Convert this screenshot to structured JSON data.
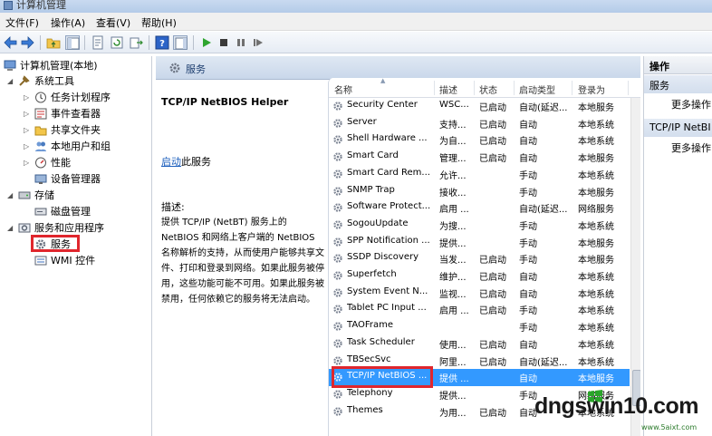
{
  "window": {
    "title": "计算机管理"
  },
  "menu": [
    "文件(F)",
    "操作(A)",
    "查看(V)",
    "帮助(H)"
  ],
  "tree": {
    "root": "计算机管理(本地)",
    "system_tools": "系统工具",
    "task_scheduler": "任务计划程序",
    "event_viewer": "事件查看器",
    "shared_folders": "共享文件夹",
    "local_users": "本地用户和组",
    "performance": "性能",
    "device_manager": "设备管理器",
    "storage": "存储",
    "disk_management": "磁盘管理",
    "services_apps": "服务和应用程序",
    "services": "服务",
    "wmi": "WMI 控件"
  },
  "panel": {
    "title": "服务",
    "service_name": "TCP/IP NetBIOS Helper",
    "start_link": "启动",
    "start_suffix": "此服务",
    "desc_label": "描述:",
    "desc_text": "提供 TCP/IP (NetBT) 服务上的 NetBIOS 和网络上客户端的 NetBIOS 名称解析的支持，从而使用户能够共享文件、打印和登录到网络。如果此服务被停用，这些功能可能不可用。如果此服务被禁用，任何依赖它的服务将无法启动。"
  },
  "columns": {
    "name": "名称",
    "desc": "描述",
    "status": "状态",
    "startup": "启动类型",
    "logon": "登录为"
  },
  "services": [
    {
      "name": "Security Center",
      "desc": "WSC...",
      "status": "已启动",
      "startup": "自动(延迟...",
      "logon": "本地服务"
    },
    {
      "name": "Server",
      "desc": "支持...",
      "status": "已启动",
      "startup": "自动",
      "logon": "本地系统"
    },
    {
      "name": "Shell Hardware ...",
      "desc": "为自...",
      "status": "已启动",
      "startup": "自动",
      "logon": "本地系统"
    },
    {
      "name": "Smart Card",
      "desc": "管理...",
      "status": "已启动",
      "startup": "自动",
      "logon": "本地服务"
    },
    {
      "name": "Smart Card Rem...",
      "desc": "允许...",
      "status": "",
      "startup": "手动",
      "logon": "本地系统"
    },
    {
      "name": "SNMP Trap",
      "desc": "接收...",
      "status": "",
      "startup": "手动",
      "logon": "本地服务"
    },
    {
      "name": "Software Protect...",
      "desc": "启用 ...",
      "status": "",
      "startup": "自动(延迟...",
      "logon": "网络服务"
    },
    {
      "name": "SogouUpdate",
      "desc": "为搜...",
      "status": "",
      "startup": "手动",
      "logon": "本地系统"
    },
    {
      "name": "SPP Notification ...",
      "desc": "提供...",
      "status": "",
      "startup": "手动",
      "logon": "本地服务"
    },
    {
      "name": "SSDP Discovery",
      "desc": "当发...",
      "status": "已启动",
      "startup": "手动",
      "logon": "本地服务"
    },
    {
      "name": "Superfetch",
      "desc": "维护...",
      "status": "已启动",
      "startup": "自动",
      "logon": "本地系统"
    },
    {
      "name": "System Event N...",
      "desc": "监视...",
      "status": "已启动",
      "startup": "自动",
      "logon": "本地系统"
    },
    {
      "name": "Tablet PC Input ...",
      "desc": "启用 ...",
      "status": "已启动",
      "startup": "手动",
      "logon": "本地系统"
    },
    {
      "name": "TAOFrame",
      "desc": "",
      "status": "",
      "startup": "手动",
      "logon": "本地系统"
    },
    {
      "name": "Task Scheduler",
      "desc": "使用...",
      "status": "已启动",
      "startup": "自动",
      "logon": "本地系统"
    },
    {
      "name": "TBSecSvc",
      "desc": "阿里...",
      "status": "已启动",
      "startup": "自动(延迟...",
      "logon": "本地系统"
    },
    {
      "name": "TCP/IP NetBIOS ...",
      "desc": "提供 ...",
      "status": "",
      "startup": "自动",
      "logon": "本地服务"
    },
    {
      "name": "Telephony",
      "desc": "提供...",
      "status": "",
      "startup": "手动",
      "logon": "网络服务"
    },
    {
      "name": "Themes",
      "desc": "为用...",
      "status": "已启动",
      "startup": "自动",
      "logon": "本地系统"
    }
  ],
  "actions": {
    "header": "操作",
    "section1": "服务",
    "more1": "更多操作",
    "section2": "TCP/IP NetBI",
    "more2": "更多操作"
  },
  "watermark": {
    "main": "dngswin10.com",
    "sub": "www.5aixt.com"
  }
}
